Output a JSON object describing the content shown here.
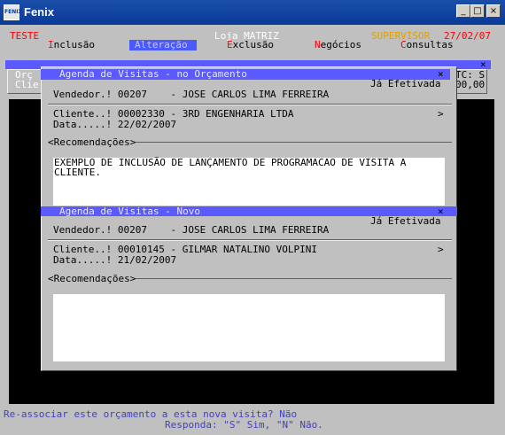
{
  "window": {
    "title": "Fenix",
    "icon_label": "FENIX",
    "minimize": "_",
    "maximize": "□",
    "close": "×"
  },
  "header": {
    "company": "TESTE",
    "store": "Loja MATRIZ",
    "user": "SUPERVISOR",
    "date": "27/02/07"
  },
  "menu": [
    {
      "hot": "I",
      "rest": "nclusão"
    },
    {
      "hot": "",
      "rest": "Alteração",
      "selected": true
    },
    {
      "hot": "E",
      "rest": "xclusão"
    },
    {
      "hot": "N",
      "rest": "egócios"
    },
    {
      "hot": "C",
      "rest": "onsultas"
    }
  ],
  "background_form": {
    "left_label_1": "Orç",
    "left_label_2": "Clie",
    "right_label_1": "TC: S",
    "right_label_2": "00,00",
    "close": "×"
  },
  "dialog1": {
    "title": "Agenda de Visitas - no Orçamento",
    "close": "×",
    "status": "Já Efetivada",
    "vendedor": "Vendedor.! 00207    - JOSE CARLOS LIMA FERREIRA",
    "cliente": "Cliente..! 00002330 - 3RD ENGENHARIA LTDA",
    "cliente_arrow": ">",
    "data": "Data.....! 22/02/2007",
    "recomendacoes_label": "<Recomendações>",
    "recomendacoes_text_1": "EXEMPLO DE INCLUSÃO DE LANÇAMENTO DE PROGRAMACAO DE VISITA A",
    "recomendacoes_text_2": "CLIENTE."
  },
  "dialog2": {
    "title": "Agenda de Visitas - Novo",
    "close": "×",
    "status": "Já Efetivada",
    "vendedor": "Vendedor.! 00207    - JOSE CARLOS LIMA FERREIRA",
    "cliente": "Cliente..! 00010145 - GILMAR NATALINO VOLPINI",
    "cliente_arrow": ">",
    "data": "Data.....! 21/02/2007",
    "recomendacoes_label": "<Recomendações>",
    "recomendacoes_text": ""
  },
  "prompt": {
    "question": "Re-associar este orçamento a esta nova visita? Não",
    "answer_hint": "Responda: \"S\" Sim, \"N\" Não."
  },
  "colors": {
    "title_bar": "#0a3a98",
    "menu_hotkey": "#ff0000",
    "menu_selected": "#4a5aff",
    "dialog_title_bar": "#5a5aff",
    "prompt_text": "#4040c0",
    "user_text": "#e0a000",
    "company_text": "#ff0000"
  }
}
